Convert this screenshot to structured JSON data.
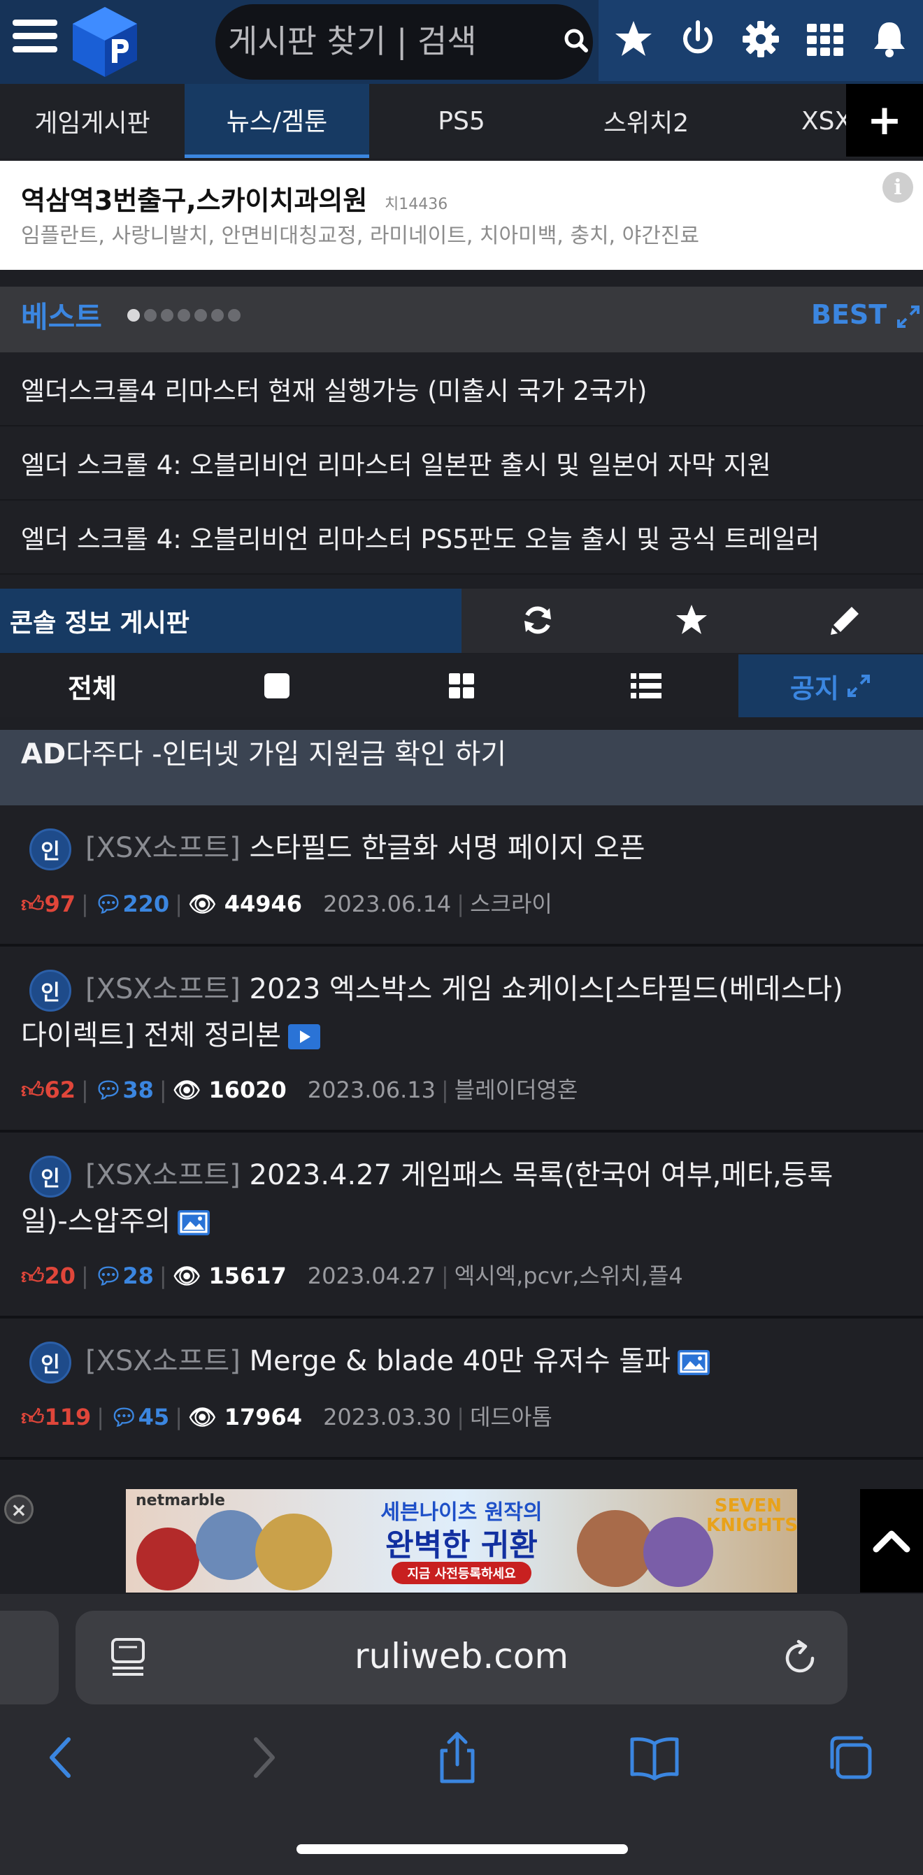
{
  "header": {
    "search_placeholder": "게시판 찾기 | 검색",
    "icons": [
      "menu-icon",
      "logo",
      "search-icon",
      "star-icon",
      "power-icon",
      "gear-icon",
      "grid-icon",
      "bell-icon"
    ]
  },
  "categories": [
    {
      "label": "게임게시판",
      "active": false
    },
    {
      "label": "뉴스/겜툰",
      "active": true
    },
    {
      "label": "PS5",
      "active": false
    },
    {
      "label": "스위치2",
      "active": false
    },
    {
      "label": "XSX",
      "active": false
    }
  ],
  "plus_label": "+",
  "ad": {
    "title": "역삼역3번출구,스카이치과의원",
    "code": "치14436",
    "desc": "임플란트, 사랑니발치, 안면비대칭교정, 라미네이트, 치아미백, 충치, 야간진료",
    "info": "i"
  },
  "best": {
    "title": "베스트",
    "link": "BEST",
    "dots": 7,
    "active_dot": 0,
    "items": [
      "엘더스크롤4 리마스터 현재 실행가능 (미출시 국가 2국가)",
      "엘더 스크롤 4: 오블리비언 리마스터 일본판 출시 및 일본어 자막 지원",
      "엘더 스크롤 4: 오블리비언 리마스터 PS5판도 오늘 출시 및 공식 트레일러"
    ]
  },
  "board": {
    "name": "콘솔 정보 게시판",
    "view_all": "전체",
    "notice": "공지"
  },
  "sponsored": {
    "prefix": "AD",
    "text": "다주다 -인터넷 가입 지원금 확인 하기"
  },
  "posts": [
    {
      "badge": "인",
      "category": "[XSX소프트]",
      "title_line1": "스타필드 한글화 서명 페이지 오픈",
      "title_line2": "",
      "media": "",
      "likes": "97",
      "comments": "220",
      "views": "44946",
      "date": "2023.06.14",
      "author": "스크라이"
    },
    {
      "badge": "인",
      "category": "[XSX소프트]",
      "title_line1": "2023 엑스박스 게임 쇼케이스[스타필드(베데스다)",
      "title_line2": "다이렉트] 전체 정리본",
      "media": "video",
      "likes": "62",
      "comments": "38",
      "views": "16020",
      "date": "2023.06.13",
      "author": "블레이더영혼"
    },
    {
      "badge": "인",
      "category": "[XSX소프트]",
      "title_line1": "2023.4.27 게임패스 목록(한국어 여부,메타,등록",
      "title_line2": "일)-스압주의",
      "media": "image",
      "likes": "20",
      "comments": "28",
      "views": "15617",
      "date": "2023.04.27",
      "author": "엑시엑,pcvr,스위치,플4"
    },
    {
      "badge": "인",
      "category": "[XSX소프트]",
      "title_line1": "Merge & blade 40만 유저수 돌파",
      "title_line2": "",
      "media": "image",
      "likes": "119",
      "comments": "45",
      "views": "17964",
      "date": "2023.03.30",
      "author": "데드아톰"
    }
  ],
  "banner": {
    "brand": "netmarble",
    "headline1": "세븐나이츠 원작의",
    "headline2": "완벽한 귀환",
    "cta": "지금 사전등록하세요",
    "logo": "SEVEN KNIGHTS",
    "close": "×"
  },
  "browser": {
    "url": "ruliweb.com"
  },
  "colors": {
    "accent": "#3b86e0",
    "header": "#163358",
    "like": "#e0463a"
  }
}
